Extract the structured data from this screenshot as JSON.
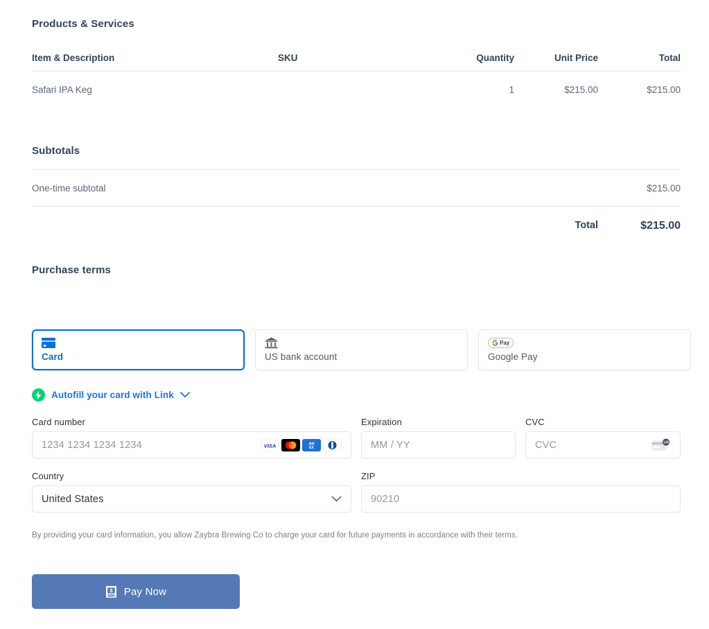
{
  "products": {
    "heading": "Products & Services",
    "columns": {
      "item": "Item & Description",
      "sku": "SKU",
      "quantity": "Quantity",
      "unit_price": "Unit Price",
      "total": "Total"
    },
    "rows": [
      {
        "item": "Safari IPA Keg",
        "sku": "",
        "quantity": "1",
        "unit_price": "$215.00",
        "total": "$215.00"
      }
    ]
  },
  "subtotals": {
    "heading": "Subtotals",
    "rows": [
      {
        "label": "One-time subtotal",
        "value": "$215.00"
      }
    ],
    "total_label": "Total",
    "total_value": "$215.00"
  },
  "purchase_terms": {
    "heading": "Purchase terms"
  },
  "payment_methods": {
    "selected": "card",
    "tabs": [
      {
        "id": "card",
        "label": "Card",
        "icon": "credit-card-icon"
      },
      {
        "id": "us_bank_account",
        "label": "US bank account",
        "icon": "bank-icon"
      },
      {
        "id": "google_pay",
        "label": "Google Pay",
        "icon": "google-pay-icon",
        "badge_text": "Pay"
      }
    ]
  },
  "link_autofill": {
    "label": "Autofill your card with Link",
    "icon": "link-bolt-icon",
    "chevron": "chevron-down-icon"
  },
  "card_form": {
    "card_number": {
      "label": "Card number",
      "placeholder": "1234 1234 1234 1234",
      "value": "",
      "brands": [
        "visa",
        "mastercard",
        "amex",
        "diners"
      ]
    },
    "expiration": {
      "label": "Expiration",
      "placeholder": "MM / YY",
      "value": ""
    },
    "cvc": {
      "label": "CVC",
      "placeholder": "CVC",
      "value": "",
      "icon": "cvc-card-icon",
      "icon_digits": "135"
    },
    "country": {
      "label": "Country",
      "value": "United States",
      "options": [
        "United States"
      ]
    },
    "zip": {
      "label": "ZIP",
      "placeholder": "90210",
      "value": ""
    }
  },
  "disclaimer": "By providing your card information, you allow Zaybra Brewing Co to charge your card for future payments in accordance with their terms.",
  "pay_button": {
    "label": "Pay Now",
    "icon": "receipt-dollar-icon",
    "color": "#5579b5"
  },
  "colors": {
    "heading": "#32435a",
    "body_text": "#5a6678",
    "accent_blue": "#0570de",
    "link_green": "#00d66f",
    "link_blue": "#1a73e8",
    "border": "#e6e6e9",
    "rule": "#e3e6ea"
  }
}
